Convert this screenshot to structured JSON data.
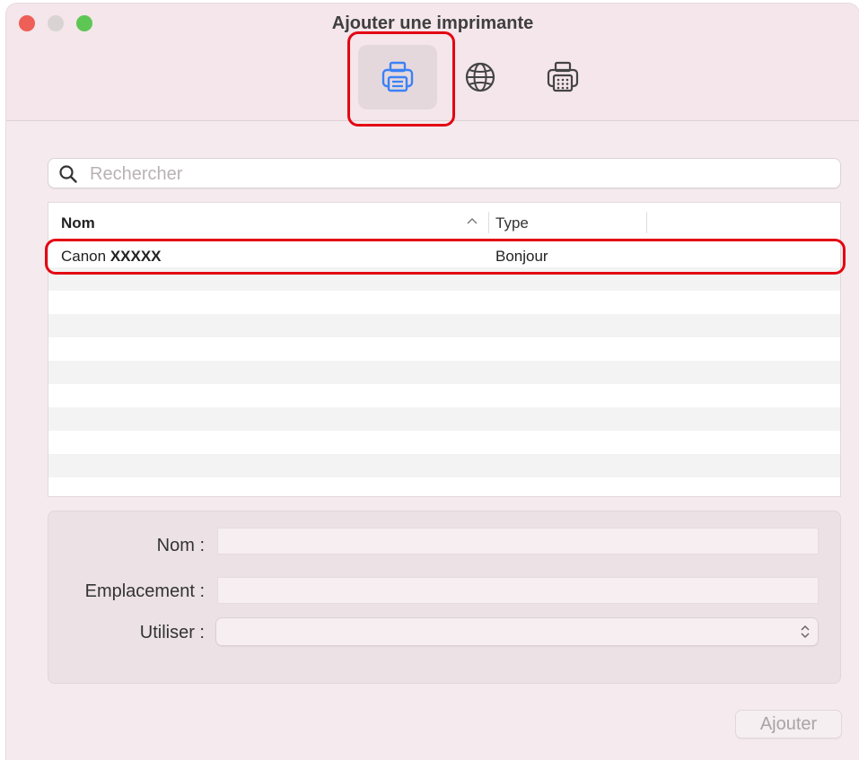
{
  "window": {
    "title": "Ajouter une imprimante"
  },
  "toolbar": {
    "items": [
      {
        "icon": "printer-icon",
        "selected": true
      },
      {
        "icon": "globe-icon",
        "selected": false
      },
      {
        "icon": "fax-printer-icon",
        "selected": false
      }
    ],
    "accent_color": "#3b82f6"
  },
  "search": {
    "placeholder": "Rechercher",
    "value": ""
  },
  "table": {
    "columns": [
      "Nom",
      "Type"
    ],
    "sort_column": "Nom",
    "rows": [
      {
        "name_prefix": "Canon ",
        "name_model": "XXXXX",
        "type": "Bonjour"
      }
    ]
  },
  "form": {
    "name_label": "Nom :",
    "location_label": "Emplacement :",
    "use_label": "Utiliser :",
    "name_value": "",
    "location_value": "",
    "use_value": ""
  },
  "actions": {
    "add_label": "Ajouter"
  },
  "highlight_color": "#e30613"
}
